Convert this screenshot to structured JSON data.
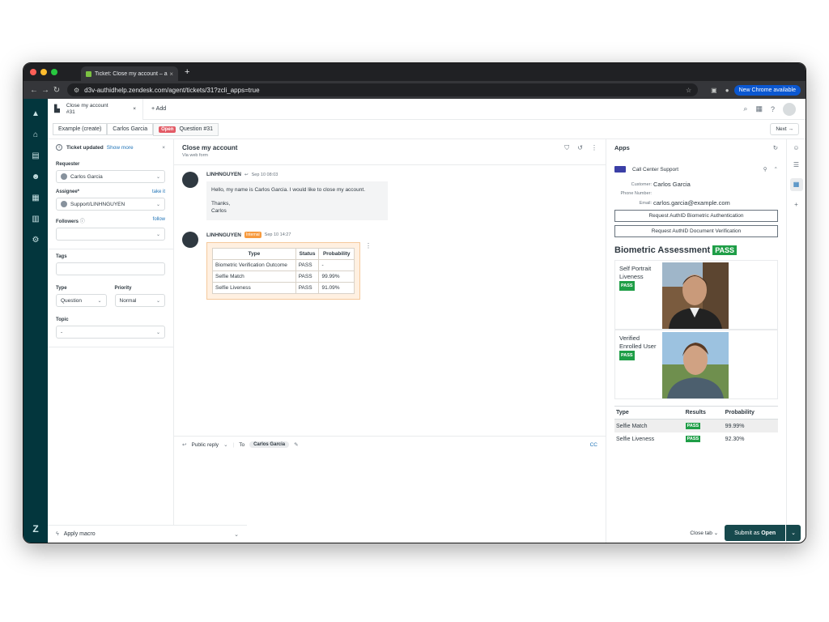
{
  "browser": {
    "tab_title": "Ticket: Close my account – a",
    "url": "d3v-authidhelp.zendesk.com/agent/tickets/31?zcli_apps=true",
    "chrome_notice": "New Chrome available"
  },
  "topbar": {
    "ticket_tab_title": "Close my account",
    "ticket_tab_number": "#31",
    "add_label": "+ Add"
  },
  "crumbs": {
    "brand": "Example (create)",
    "requester": "Carlos Garcia",
    "status_badge": "Open",
    "ticket": "Question #31",
    "next": "Next →"
  },
  "properties": {
    "notice_title": "Ticket updated",
    "notice_link": "Show more",
    "requester_label": "Requester",
    "requester_value": "Carlos Garcia",
    "assignee_label": "Assignee*",
    "assignee_link": "take it",
    "assignee_value": "Support/LINHNGUYEN",
    "followers_label": "Followers",
    "followers_link": "follow",
    "tags_label": "Tags",
    "type_label": "Type",
    "type_value": "Question",
    "priority_label": "Priority",
    "priority_value": "Normal",
    "topic_label": "Topic",
    "topic_value": "-"
  },
  "macro": {
    "label": "Apply macro"
  },
  "conversation": {
    "title": "Close my account",
    "subtitle": "Via web form",
    "messages": [
      {
        "author": "LINHNGUYEN",
        "time": "Sep 10 08:03",
        "line1": "Hello, my name is Carlos Garcia.  I would like to close my account.",
        "line2": "Thanks,",
        "line3": "Carlos"
      },
      {
        "author": "LINHNGUYEN",
        "badge": "Internal",
        "time": "Sep 10 14:27",
        "table_headers": [
          "Type",
          "Status",
          "Probability"
        ],
        "table_rows": [
          [
            "Biometric Verification Outcome",
            "PASS",
            "-"
          ],
          [
            "Selfie Match",
            "PASS",
            "99.99%"
          ],
          [
            "Selfie Liveness",
            "PASS",
            "91.09%"
          ]
        ]
      }
    ]
  },
  "composer": {
    "mode": "Public reply",
    "to_label": "To",
    "to_chip": "Carlos Garcia",
    "cc": "CC"
  },
  "apps": {
    "header": "Apps",
    "app_name": "Call Center Support",
    "customer_label": "Customer:",
    "customer_value": "Carlos Garcia",
    "phone_label": "Phone Number:",
    "phone_value": "",
    "email_label": "Email:",
    "email_value": "carlos.garcia@example.com",
    "btn_biometric": "Request AuthID Biometric Authentication",
    "btn_document": "Request AuthID Document Verification",
    "bio_title": "Biometric Assessment",
    "bio_status": "PASS",
    "photo1_caption": "Self Portrait Liveness",
    "photo1_status": "PASS",
    "photo2_caption": "Verified Enrolled User",
    "photo2_status": "PASS",
    "results_headers": [
      "Type",
      "Results",
      "Probability"
    ],
    "results_rows": [
      [
        "Selfie Match",
        "PASS",
        "99.99%"
      ],
      [
        "Selfie Liveness",
        "PASS",
        "92.30%"
      ]
    ]
  },
  "footer": {
    "close_tab": "Close tab",
    "submit_prefix": "Submit as",
    "submit_status": "Open"
  },
  "colors": {
    "rail": "#03363d",
    "pass": "#1f9e47",
    "open_badge": "#e35b66",
    "internal": "#f79a3e",
    "submit": "#17494d"
  }
}
